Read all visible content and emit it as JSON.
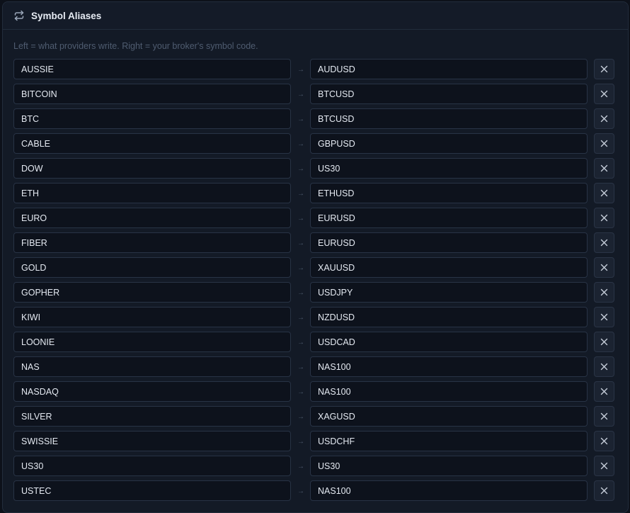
{
  "header": {
    "title": "Symbol Aliases",
    "icon": "repeat-icon"
  },
  "hint": "Left = what providers write. Right = your broker's symbol code.",
  "arrow_glyph": "→",
  "colors": {
    "background": "#131a26",
    "field_bg": "#0d121c",
    "border": "#283345",
    "text": "#e4e9f1",
    "muted": "#4f5c70"
  },
  "aliases": [
    {
      "alias": "AUSSIE",
      "symbol": "AUDUSD"
    },
    {
      "alias": "BITCOIN",
      "symbol": "BTCUSD"
    },
    {
      "alias": "BTC",
      "symbol": "BTCUSD"
    },
    {
      "alias": "CABLE",
      "symbol": "GBPUSD"
    },
    {
      "alias": "DOW",
      "symbol": "US30"
    },
    {
      "alias": "ETH",
      "symbol": "ETHUSD"
    },
    {
      "alias": "EURO",
      "symbol": "EURUSD"
    },
    {
      "alias": "FIBER",
      "symbol": "EURUSD"
    },
    {
      "alias": "GOLD",
      "symbol": "XAUUSD"
    },
    {
      "alias": "GOPHER",
      "symbol": "USDJPY"
    },
    {
      "alias": "KIWI",
      "symbol": "NZDUSD"
    },
    {
      "alias": "LOONIE",
      "symbol": "USDCAD"
    },
    {
      "alias": "NAS",
      "symbol": "NAS100"
    },
    {
      "alias": "NASDAQ",
      "symbol": "NAS100"
    },
    {
      "alias": "SILVER",
      "symbol": "XAGUSD"
    },
    {
      "alias": "SWISSIE",
      "symbol": "USDCHF"
    },
    {
      "alias": "US30",
      "symbol": "US30"
    },
    {
      "alias": "USTEC",
      "symbol": "NAS100"
    }
  ]
}
